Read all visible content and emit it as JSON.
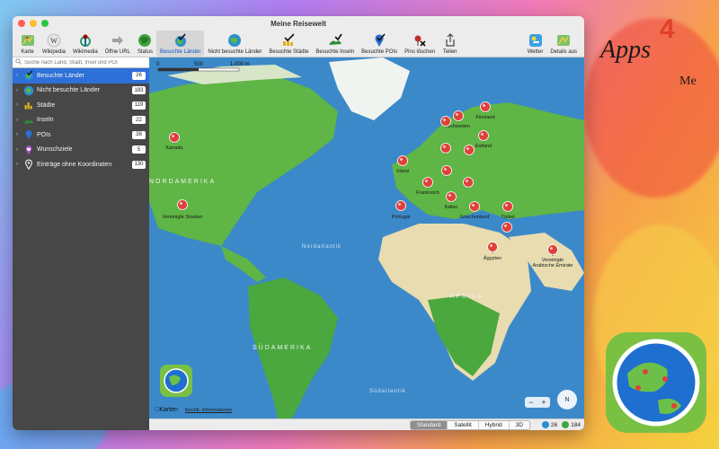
{
  "window": {
    "title": "Meine Reisewelt"
  },
  "toolbar": {
    "items": [
      {
        "label": "Karte",
        "icon": "map-icon"
      },
      {
        "label": "Wikipedia",
        "icon": "wikipedia-icon"
      },
      {
        "label": "Wikimedia",
        "icon": "wikimedia-icon"
      },
      {
        "label": "Öffne URL",
        "icon": "arrow-right-icon"
      },
      {
        "label": "Status",
        "icon": "status-globe-icon"
      },
      {
        "label": "Besuchte Länder",
        "icon": "visited-countries-icon"
      },
      {
        "label": "Nicht besuchte Länder",
        "icon": "globe-icon"
      },
      {
        "label": "Besuchte Städte",
        "icon": "city-check-icon"
      },
      {
        "label": "Besuchte Inseln",
        "icon": "island-icon"
      },
      {
        "label": "Besuchte POIs",
        "icon": "poi-icon"
      },
      {
        "label": "Pins löschen",
        "icon": "delete-pins-icon"
      },
      {
        "label": "Teilen",
        "icon": "share-icon"
      },
      {
        "label": "Wetter",
        "icon": "weather-icon"
      },
      {
        "label": "Details aus",
        "icon": "details-icon"
      }
    ]
  },
  "search": {
    "placeholder": "Suche nach Land, Stadt, Insel und POI"
  },
  "sidebar": {
    "items": [
      {
        "label": "Besuchte Länder",
        "count": "26"
      },
      {
        "label": "Nicht besuchte Länder",
        "count": "183"
      },
      {
        "label": "Städte",
        "count": "119"
      },
      {
        "label": "Inseln",
        "count": "22"
      },
      {
        "label": "POIs",
        "count": "38"
      },
      {
        "label": "Wunschziele",
        "count": "5"
      },
      {
        "label": "Einträge ohne Koordinaten",
        "count": "130"
      }
    ]
  },
  "map": {
    "scale": [
      "0",
      "500",
      "1.000 m"
    ],
    "regions": [
      "NORDAMERIKA",
      "Nordatlantik",
      "AFRIKA",
      "SÜDAMERIKA",
      "Südatlantik"
    ],
    "pins": [
      {
        "label": "Kanada"
      },
      {
        "label": "Vereinigte Staaten"
      },
      {
        "label": "Irland"
      },
      {
        "label": "Portugal"
      },
      {
        "label": "Frankreich"
      },
      {
        "label": "Italien"
      },
      {
        "label": "Griechenland"
      },
      {
        "label": "Türkei"
      },
      {
        "label": "Ägypten"
      },
      {
        "label": "Vereinigte Arabische Emirate"
      },
      {
        "label": "Schweden"
      },
      {
        "label": "Finnland"
      },
      {
        "label": "Estland"
      },
      {
        "label": ""
      },
      {
        "label": ""
      },
      {
        "label": ""
      },
      {
        "label": ""
      },
      {
        "label": ""
      },
      {
        "label": ""
      }
    ],
    "attribution": "Karten",
    "legal": "Rechtl. Informationen",
    "zoom_out": "−",
    "zoom_in": "+",
    "compass": "N"
  },
  "statusbar": {
    "modes": [
      "Standard",
      "Satellit",
      "Hybrid",
      "3D"
    ],
    "selected_mode": "Standard",
    "visited": "26",
    "total": "184"
  },
  "brand": {
    "text": "Apps",
    "numeral": "4",
    "suffix": "Me"
  },
  "colors": {
    "accent": "#2f6fd8",
    "pin": "#e0403a",
    "sidebar": "#474747",
    "ocean": "#3c89c9",
    "land": "#5fb545"
  }
}
